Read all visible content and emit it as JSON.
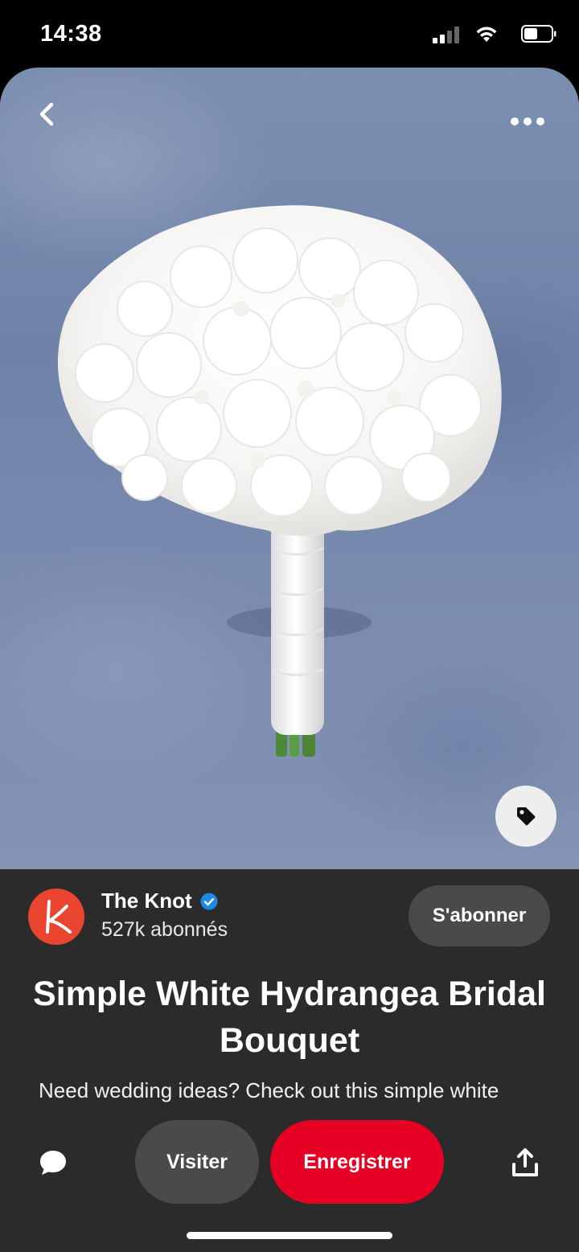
{
  "status_bar": {
    "time": "14:38",
    "icons": [
      "cellular-signal-icon",
      "wifi-icon",
      "battery-icon"
    ]
  },
  "header": {
    "back_icon": "chevron-left-icon",
    "more_icon": "more-horizontal-icon"
  },
  "image": {
    "subject": "white hydrangea bridal bouquet",
    "tag_icon": "tag-icon"
  },
  "creator": {
    "name": "The Knot",
    "verified": true,
    "followers": "527k abonnés",
    "avatar_letter": "k",
    "follow_label": "S'abonner"
  },
  "pin": {
    "title": "Simple White Hydrangea Bridal Bouquet",
    "description": "Need wedding ideas? Check out this simple white"
  },
  "actions": {
    "comment_icon": "comment-icon",
    "visit_label": "Visiter",
    "save_label": "Enregistrer",
    "share_icon": "share-icon"
  },
  "colors": {
    "accent": "#e60023",
    "panel": "#2b2b2b",
    "secondary_button": "#4a4a4a",
    "avatar_bg": "#e9452f",
    "verified": "#1e88e5"
  }
}
